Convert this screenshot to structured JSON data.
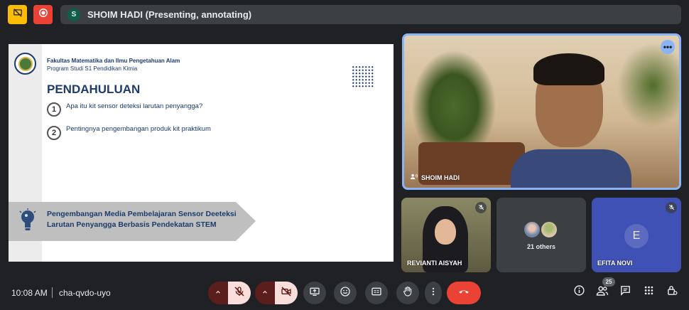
{
  "top_bar": {
    "presenter_initial": "S",
    "presenting_text": "SHOIM HADI (Presenting, annotating)"
  },
  "slide": {
    "faculty": "Fakultas Matematika dan Ilmu Pengetahuan Alam",
    "program": "Program Studi S1 Pendidikan Kimia",
    "title": "PENDAHULUAN",
    "points": [
      {
        "num": "1",
        "text": "Apa itu kit sensor deteksi larutan penyangga?"
      },
      {
        "num": "2",
        "text": "Pentingnya pengembangan produk kit praktikum"
      }
    ],
    "banner_line1": "Pengembangan Media Pembelajaran Sensor Deeteksi",
    "banner_line2": "Larutan Penyangga Berbasis Pendekatan STEM"
  },
  "tiles": {
    "main_name": "SHOIM HADI",
    "rev_name": "REVIANTI AISYAH",
    "others_text": "21 others",
    "efita_initial": "E",
    "efita_name": "EFITA NOVI"
  },
  "bottom": {
    "time": "10:08 AM",
    "meeting_code": "cha-qvdo-uyo",
    "people_count": "25"
  },
  "colors": {
    "accent": "#8ab4f8",
    "end_call": "#ea4335",
    "tile_blue": "#3f51b5",
    "slide_title": "#1d3b6b"
  },
  "icons": [
    "present-icon",
    "record-icon",
    "mic-off-icon",
    "camera-off-icon",
    "present-screen-icon",
    "emoji-icon",
    "captions-icon",
    "raise-hand-icon",
    "more-options-icon",
    "end-call-icon",
    "info-icon",
    "people-icon",
    "chat-icon",
    "activities-icon",
    "host-controls-icon"
  ]
}
